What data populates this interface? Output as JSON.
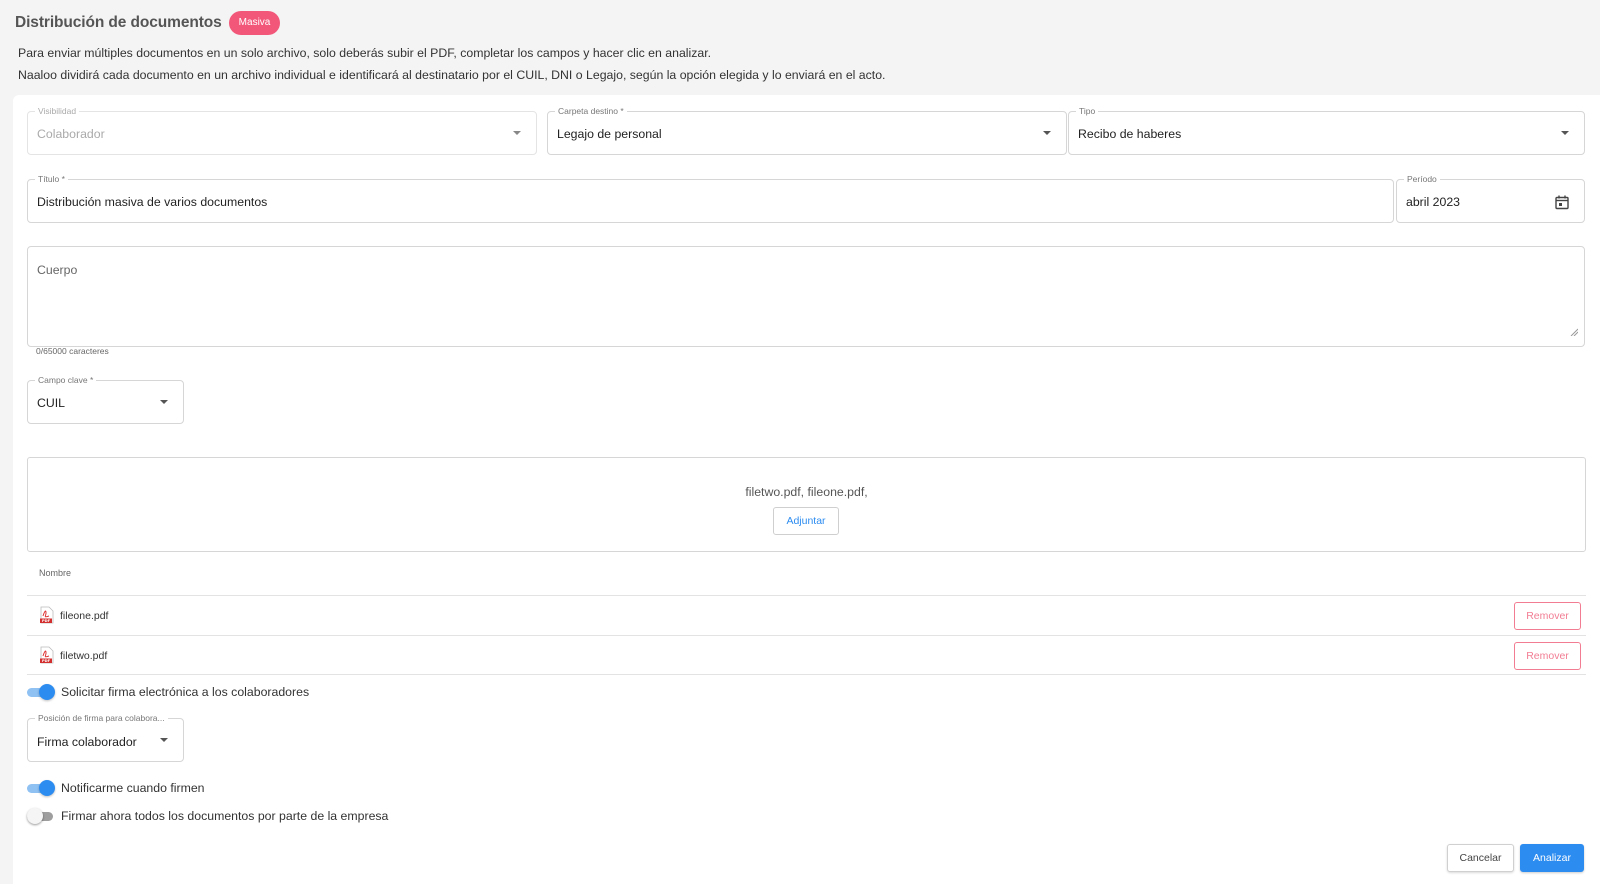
{
  "header": {
    "title": "Distribución de documentos",
    "badge": "Masiva",
    "description_line1": "Para enviar múltiples documentos en un solo archivo, solo deberás subir el PDF, completar los campos y hacer clic en analizar.",
    "description_line2": "Naaloo dividirá cada documento en un archivo individual e identificará al destinatario por el CUIL, DNI o Legajo, según la opción elegida y lo enviará en el acto."
  },
  "form": {
    "visibility": {
      "label": "Visibilidad",
      "value": "Colaborador"
    },
    "folder": {
      "label": "Carpeta destino *",
      "value": "Legajo de personal"
    },
    "type": {
      "label": "Tipo",
      "value": "Recibo de haberes"
    },
    "title": {
      "label": "Título *",
      "value": "Distribución masiva de varios documentos"
    },
    "period": {
      "label": "Período",
      "value": "abril 2023"
    },
    "body": {
      "placeholder": "Cuerpo",
      "char_count": "0/65000 caracteres"
    },
    "key_field": {
      "label": "Campo clave *",
      "value": "CUIL"
    },
    "signature_position": {
      "label": "Posición de firma para colabora...",
      "value": "Firma colaborador"
    }
  },
  "upload": {
    "files_summary": "filetwo.pdf, fileone.pdf,",
    "attach_label": "Adjuntar",
    "column_header": "Nombre",
    "files": [
      {
        "name": "fileone.pdf",
        "remove_label": "Remover"
      },
      {
        "name": "filetwo.pdf",
        "remove_label": "Remover"
      }
    ]
  },
  "toggles": {
    "request_signature": {
      "label": "Solicitar firma electrónica a los colaboradores",
      "on": true
    },
    "notify_me": {
      "label": "Notificarme cuando firmen",
      "on": true
    },
    "sign_now": {
      "label": "Firmar ahora todos los documentos por parte de la empresa",
      "on": false
    }
  },
  "actions": {
    "cancel_label": "Cancelar",
    "analyze_label": "Analizar"
  },
  "colors": {
    "accent": "#2d8cf0",
    "badge": "#f2577a",
    "remove": "#f27d93"
  }
}
